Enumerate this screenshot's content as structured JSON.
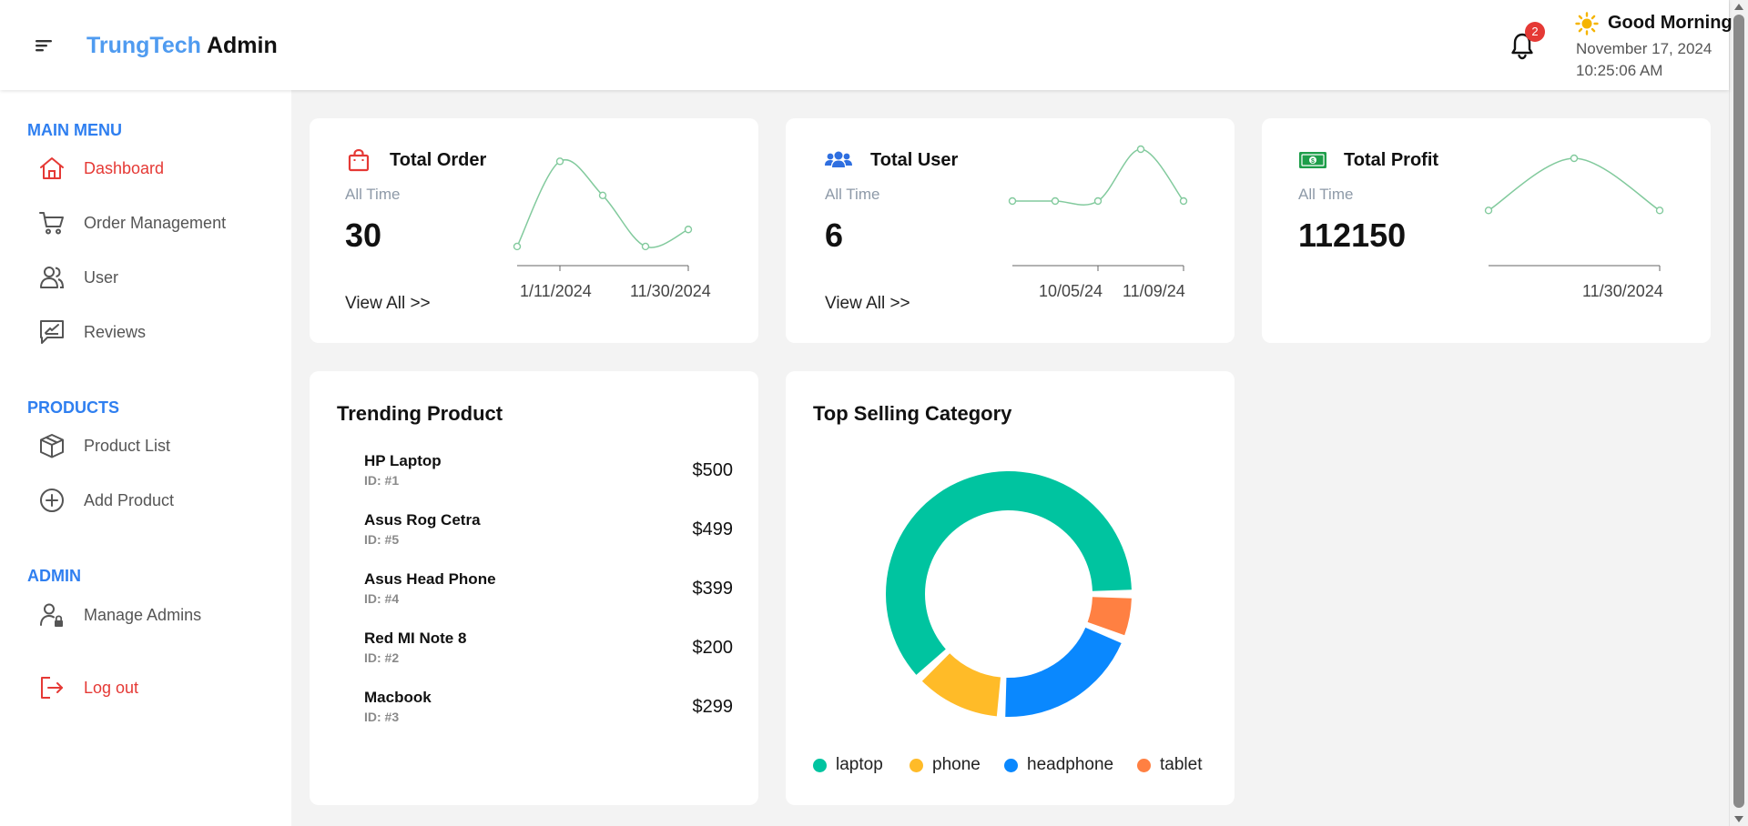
{
  "header": {
    "brand_first": "TrungTech",
    "brand_second": "Admin",
    "notification_count": "2",
    "greeting": "Good Morning",
    "date": "November 17, 2024",
    "time": "10:25:06 AM"
  },
  "sidebar": {
    "main_menu_title": "MAIN MENU",
    "main_items": [
      {
        "label": "Dashboard",
        "icon": "home-icon",
        "active": true
      },
      {
        "label": "Order Management",
        "icon": "cart-icon"
      },
      {
        "label": "User",
        "icon": "users-icon"
      },
      {
        "label": "Reviews",
        "icon": "review-icon"
      }
    ],
    "products_title": "PRODUCTS",
    "product_items": [
      {
        "label": "Product List",
        "icon": "box-icon"
      },
      {
        "label": "Add Product",
        "icon": "plus-circle-icon"
      }
    ],
    "admin_title": "ADMIN",
    "admin_items": [
      {
        "label": "Manage Admins",
        "icon": "admin-lock-icon"
      }
    ],
    "logout_label": "Log out"
  },
  "stats": [
    {
      "title": "Total Order",
      "subtitle": "All Time",
      "value": "30",
      "link": "View All >>",
      "icon": "shopping-bag-icon",
      "icon_color": "#e53935",
      "spark": {
        "values": [
          0.6,
          4.6,
          3.0,
          0.6,
          1.4
        ],
        "ymin": 0,
        "ymax": 5
      },
      "ticks": [
        "1/11/2024",
        "11/30/2024"
      ]
    },
    {
      "title": "Total User",
      "subtitle": "All Time",
      "value": "6",
      "link": "View All >>",
      "icon": "users-group-icon",
      "icon_color": "#2f6fe0",
      "spark": {
        "values": [
          1,
          1,
          1,
          3,
          1
        ],
        "ymin": -1,
        "ymax": 3
      },
      "ticks": [
        "10/05/24",
        "11/09/24"
      ]
    },
    {
      "title": "Total Profit",
      "subtitle": "All Time",
      "value": "112150",
      "icon": "cash-icon",
      "icon_color": "#1e9e4a",
      "spark": {
        "values": [
          1,
          3,
          1
        ],
        "ymin": 0,
        "ymax": 3
      },
      "ticks": [
        "11/30/2024"
      ]
    }
  ],
  "trending": {
    "title": "Trending Product",
    "items": [
      {
        "name": "HP Laptop",
        "id": "ID: #1",
        "price": "$500"
      },
      {
        "name": "Asus Rog Cetra",
        "id": "ID: #5",
        "price": "$499"
      },
      {
        "name": "Asus Head Phone",
        "id": "ID: #4",
        "price": "$399"
      },
      {
        "name": "Red MI Note 8",
        "id": "ID: #2",
        "price": "$200"
      },
      {
        "name": "Macbook",
        "id": "ID: #3",
        "price": "$299"
      }
    ]
  },
  "chart_data": {
    "type": "pie",
    "title": "Top Selling Category",
    "categories": [
      "laptop",
      "phone",
      "headphone",
      "tablet"
    ],
    "values": [
      62,
      12,
      20,
      6
    ],
    "colors": [
      "#00c4a0",
      "#ffbb28",
      "#0a88fe",
      "#ff8042"
    ],
    "legend": "bottom"
  },
  "colors": {
    "accent": "#2f7ff0",
    "active": "#e53935",
    "spark_line": "#82ca9d"
  }
}
